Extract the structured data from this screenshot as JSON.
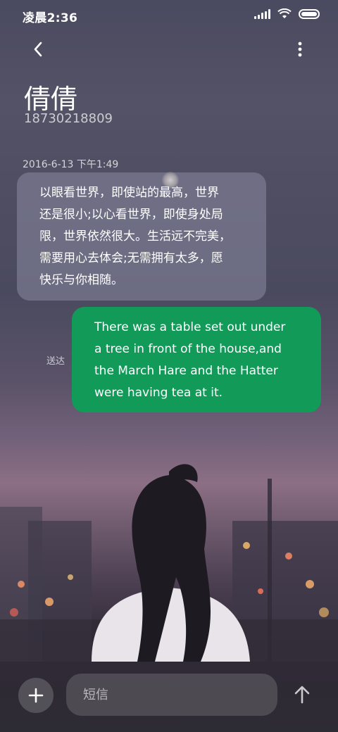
{
  "status_bar": {
    "time": "凌晨2:36",
    "signal_icon": "signal-icon",
    "wifi_icon": "wifi-icon",
    "battery_icon": "battery-icon"
  },
  "header": {
    "back_icon": "chevron-left-icon",
    "more_icon": "more-vertical-icon",
    "contact_name": "倩倩",
    "contact_number": "18730218809"
  },
  "conversation": {
    "timestamp": "2016-6-13 下午1:49",
    "messages": [
      {
        "direction": "incoming",
        "lines": [
          "以眼看世界，即使站的最高，世界",
          "还是很小;以心看世界，即使身处局",
          "限，世界依然很大。生活远不完美，",
          "需要用心去体会;无需拥有太多，愿",
          "快乐与你相随。"
        ]
      },
      {
        "direction": "outgoing",
        "status": "送达",
        "lines": [
          "There was a table set out under",
          "a tree in front of the house,and",
          "the March Hare and the Hatter",
          "were having tea at it."
        ]
      }
    ]
  },
  "composer": {
    "add_icon": "plus-icon",
    "placeholder": "短信",
    "value": "",
    "send_icon": "arrow-up-icon"
  },
  "colors": {
    "outgoing_bubble": "#129a58",
    "incoming_bubble": "rgba(150,150,175,0.45)"
  }
}
